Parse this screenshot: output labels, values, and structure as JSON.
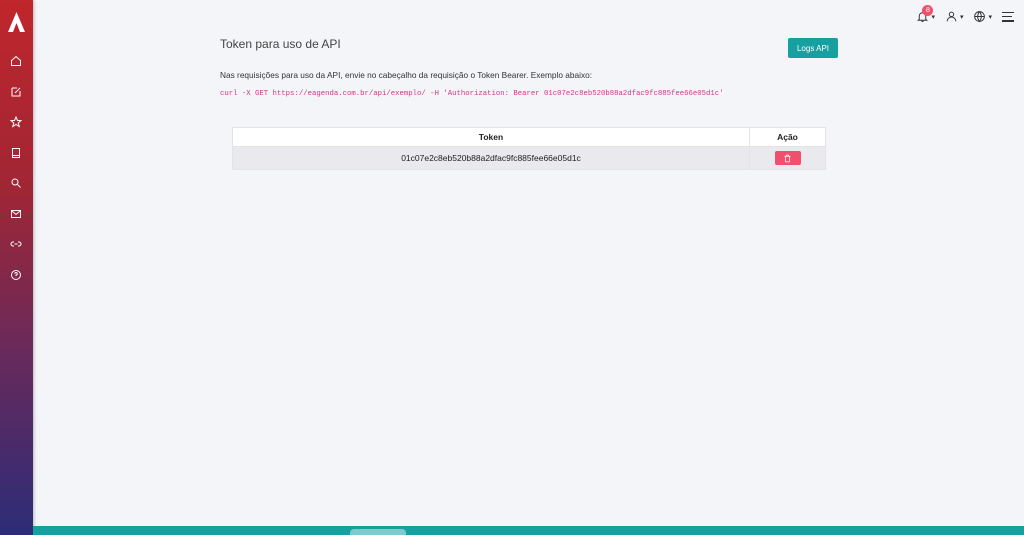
{
  "sidebar": {
    "logo": "app-logo",
    "items": [
      {
        "icon": "home-icon"
      },
      {
        "icon": "edit-icon"
      },
      {
        "icon": "star-icon"
      },
      {
        "icon": "book-icon"
      },
      {
        "icon": "search-icon"
      },
      {
        "icon": "mail-icon"
      },
      {
        "icon": "link-icon"
      },
      {
        "icon": "help-icon"
      }
    ]
  },
  "topbar": {
    "notification_count": "8",
    "icons": [
      "bell-icon",
      "user-icon",
      "globe-icon",
      "menu-icon"
    ]
  },
  "main": {
    "title": "Token para uso de API",
    "logs_button": "Logs API",
    "description": "Nas requisições para uso da API, envie no cabeçalho da requisição o Token Bearer. Exemplo abaixo:",
    "curl_example": "curl -X GET https://eagenda.com.br/api/exemplo/ -H 'Authorization: Bearer 01c07e2c8eb520b88a2dfac9fc885fee66e05d1c'",
    "table": {
      "headers": [
        "Token",
        "Ação"
      ],
      "rows": [
        {
          "token": "01c07e2c8eb520b88a2dfac9fc885fee66e05d1c",
          "action_icon": "trash-icon"
        }
      ]
    }
  },
  "colors": {
    "accent": "#17a0a0",
    "danger": "#f0506e",
    "code": "#d63384"
  }
}
